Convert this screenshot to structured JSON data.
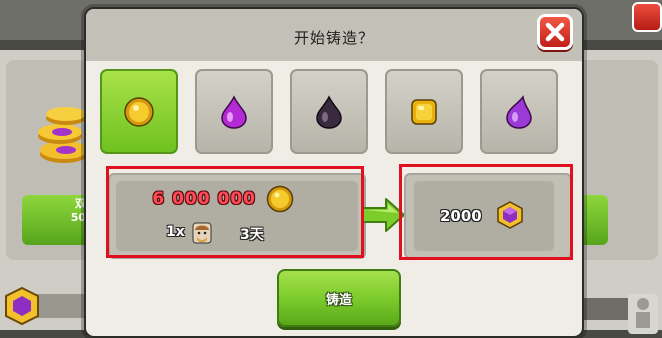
{
  "dialog": {
    "title": "开始铸造？",
    "close_icon": "close-x-icon"
  },
  "resources": [
    {
      "name": "gold",
      "icon": "gold-coin-icon",
      "selected": true
    },
    {
      "name": "elixir",
      "icon": "elixir-drop-icon",
      "selected": false
    },
    {
      "name": "dark-elixir",
      "icon": "dark-elixir-drop-icon",
      "selected": false
    },
    {
      "name": "builder-gold",
      "icon": "builder-gold-icon",
      "selected": false
    },
    {
      "name": "builder-elixir",
      "icon": "builder-elixir-drop-icon",
      "selected": false
    }
  ],
  "cost": {
    "amount": "6 000 000",
    "currency_icon": "gold-coin-icon",
    "builders": "1x",
    "builder_icon": "builder-face-icon",
    "duration": "3天"
  },
  "result": {
    "amount": "2000",
    "icon": "capital-gold-gem-icon"
  },
  "forge_button": {
    "label": "铸造"
  },
  "background": {
    "left_button_text": "50",
    "left_button_prefix": "双"
  },
  "colors": {
    "accent_green": "#7ccc2c",
    "highlight_red": "#e0101e",
    "cost_red": "#ff4b55",
    "close_red": "#d8281f"
  }
}
